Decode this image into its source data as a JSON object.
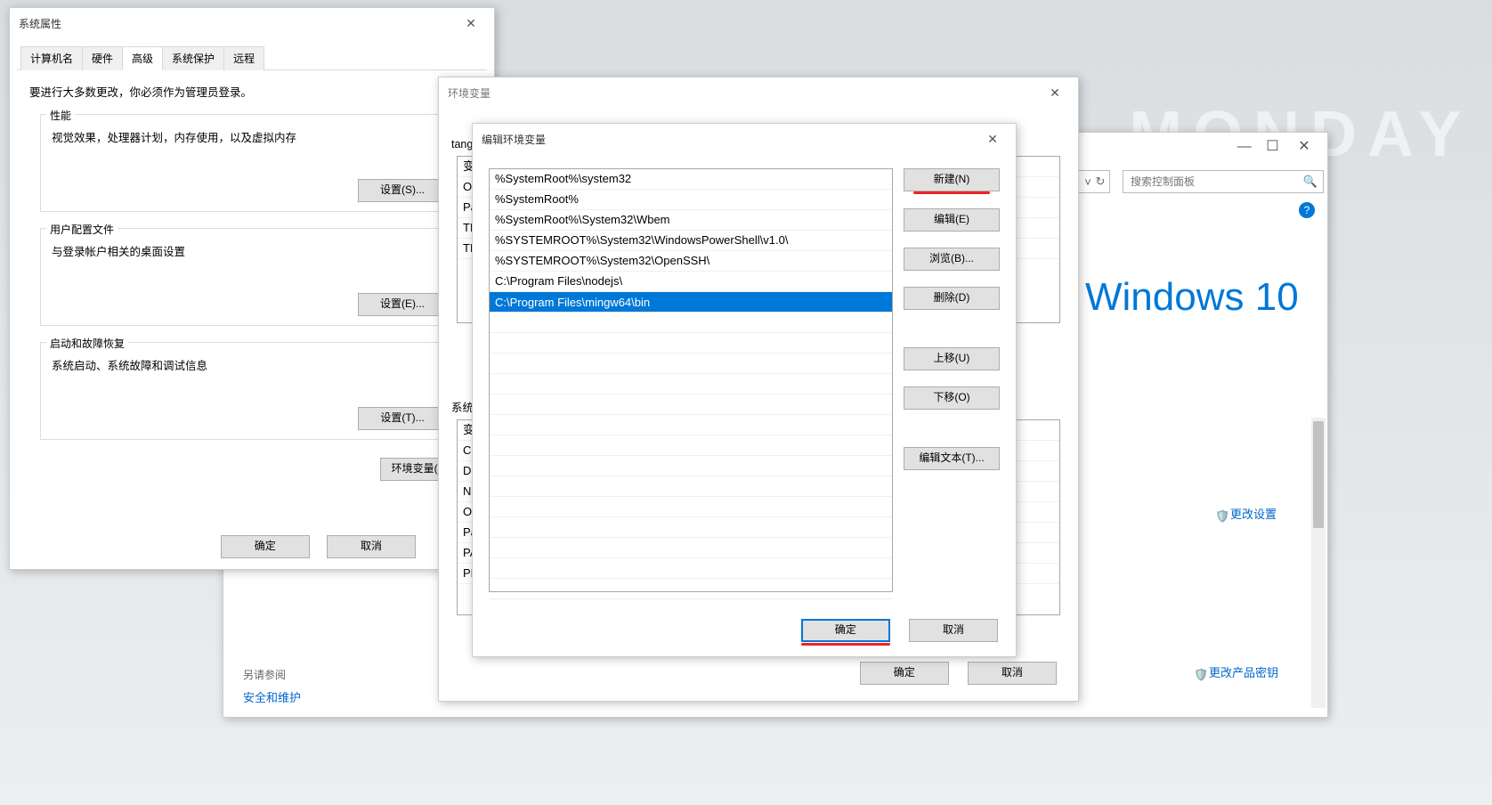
{
  "desktop": {
    "day": "MONDAY"
  },
  "cp": {
    "searchPlaceholder": "搜索控制面板",
    "refresh": "↻",
    "brand": "Windows 10",
    "changeSettings": "更改设置",
    "changeKey": "更改产品密钥",
    "minimize": "—",
    "maximize": "☐",
    "close": "✕"
  },
  "sysprops": {
    "title": "系统属性",
    "close": "✕",
    "tabs": [
      "计算机名",
      "硬件",
      "高级",
      "系统保护",
      "远程"
    ],
    "adminNote": "要进行大多数更改，你必须作为管理员登录。",
    "perfTitle": "性能",
    "perfDesc": "视觉效果，处理器计划，内存使用，以及虚拟内存",
    "perfBtn": "设置(S)...",
    "profTitle": "用户配置文件",
    "profDesc": "与登录帐户相关的桌面设置",
    "profBtn": "设置(E)...",
    "startTitle": "启动和故障恢复",
    "startDesc": "系统启动、系统故障和调试信息",
    "startBtn": "设置(T)...",
    "envBtn": "环境变量(N)...",
    "ok": "确定",
    "cancel": "取消",
    "seeAlso": "另请参阅",
    "secLink": "安全和维护"
  },
  "env": {
    "title": "环境变量",
    "close": "✕",
    "userVars": "tang 的用户变量",
    "sysVars": "系统变量(S)",
    "userItems": [
      "变",
      "On",
      "Pa",
      "TE",
      "TM"
    ],
    "sysItems": [
      "变",
      "Co",
      "Dr",
      "NU",
      "OS",
      "Pa",
      "PA",
      "PR"
    ],
    "ok": "确定",
    "cancel": "取消"
  },
  "edit": {
    "title": "编辑环境变量",
    "close": "✕",
    "entries": [
      "%SystemRoot%\\system32",
      "%SystemRoot%",
      "%SystemRoot%\\System32\\Wbem",
      "%SYSTEMROOT%\\System32\\WindowsPowerShell\\v1.0\\",
      "%SYSTEMROOT%\\System32\\OpenSSH\\",
      "C:\\Program Files\\nodejs\\",
      "C:\\Program Files\\mingw64\\bin"
    ],
    "new": "新建(N)",
    "editBtn": "编辑(E)",
    "browse": "浏览(B)...",
    "del": "删除(D)",
    "up": "上移(U)",
    "down": "下移(O)",
    "editText": "编辑文本(T)...",
    "ok": "确定",
    "cancel": "取消"
  }
}
